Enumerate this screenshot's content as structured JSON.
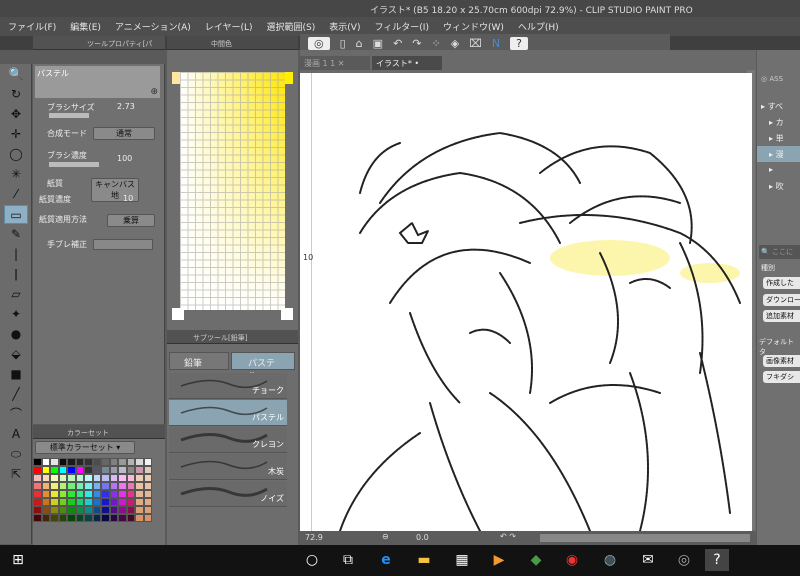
{
  "window": {
    "title": "イラスト* (B5 18.20 x 25.70cm 600dpi 72.9%) - CLIP STUDIO PAINT PRO"
  },
  "menu": [
    "ファイル(F)",
    "編集(E)",
    "アニメーション(A)",
    "レイヤー(L)",
    "選択範囲(S)",
    "表示(V)",
    "フィルター(I)",
    "ウィンドウ(W)",
    "ヘルプ(H)"
  ],
  "panels": {
    "tool_property_tab": "ツールプロパティ[パ",
    "color_tab": "中間色",
    "subtool_tab": "サブツール[鉛筆]",
    "colorset_tab": "カラーセット"
  },
  "tool_property": {
    "preview_label": "パステル",
    "brush_size_label": "ブラシサイズ",
    "brush_size": "2.73",
    "blend_label": "合成モード",
    "blend_value": "通常",
    "density_label": "ブラシ濃度",
    "density": "100",
    "paper_label": "紙質",
    "paper_value": "キャンバス地",
    "paper_density_label": "紙質濃度",
    "paper_density": "10",
    "paper_method_label": "紙質適用方法",
    "paper_method": "乗算",
    "stabilize_label": "手ブレ補正"
  },
  "colorset": {
    "selected": "標準カラーセット"
  },
  "subtool": {
    "groups": [
      "鉛筆",
      "パステル"
    ],
    "items": [
      "チョーク",
      "パステル",
      "クレヨン",
      "木炭",
      "ノイズ"
    ],
    "selected": "パステル"
  },
  "canvas": {
    "tabs": [
      "漫画 1 1",
      "イラスト*"
    ],
    "active_tab": "イラスト*",
    "ruler_mark": "10",
    "zoom": "72.9",
    "angle": "0.0"
  },
  "right_panel": {
    "header": "ASS",
    "tree": [
      "すべ",
      "カ",
      "単",
      "漫",
      "",
      "吹"
    ],
    "search_placeholder": "ここに",
    "type_label": "種別",
    "chips": [
      "作成した",
      "ダウンロー",
      "追加素材",
      "画像素材",
      "フキダシ"
    ],
    "default_label": "デフォルトタ"
  },
  "accent": "#8fb0c4"
}
